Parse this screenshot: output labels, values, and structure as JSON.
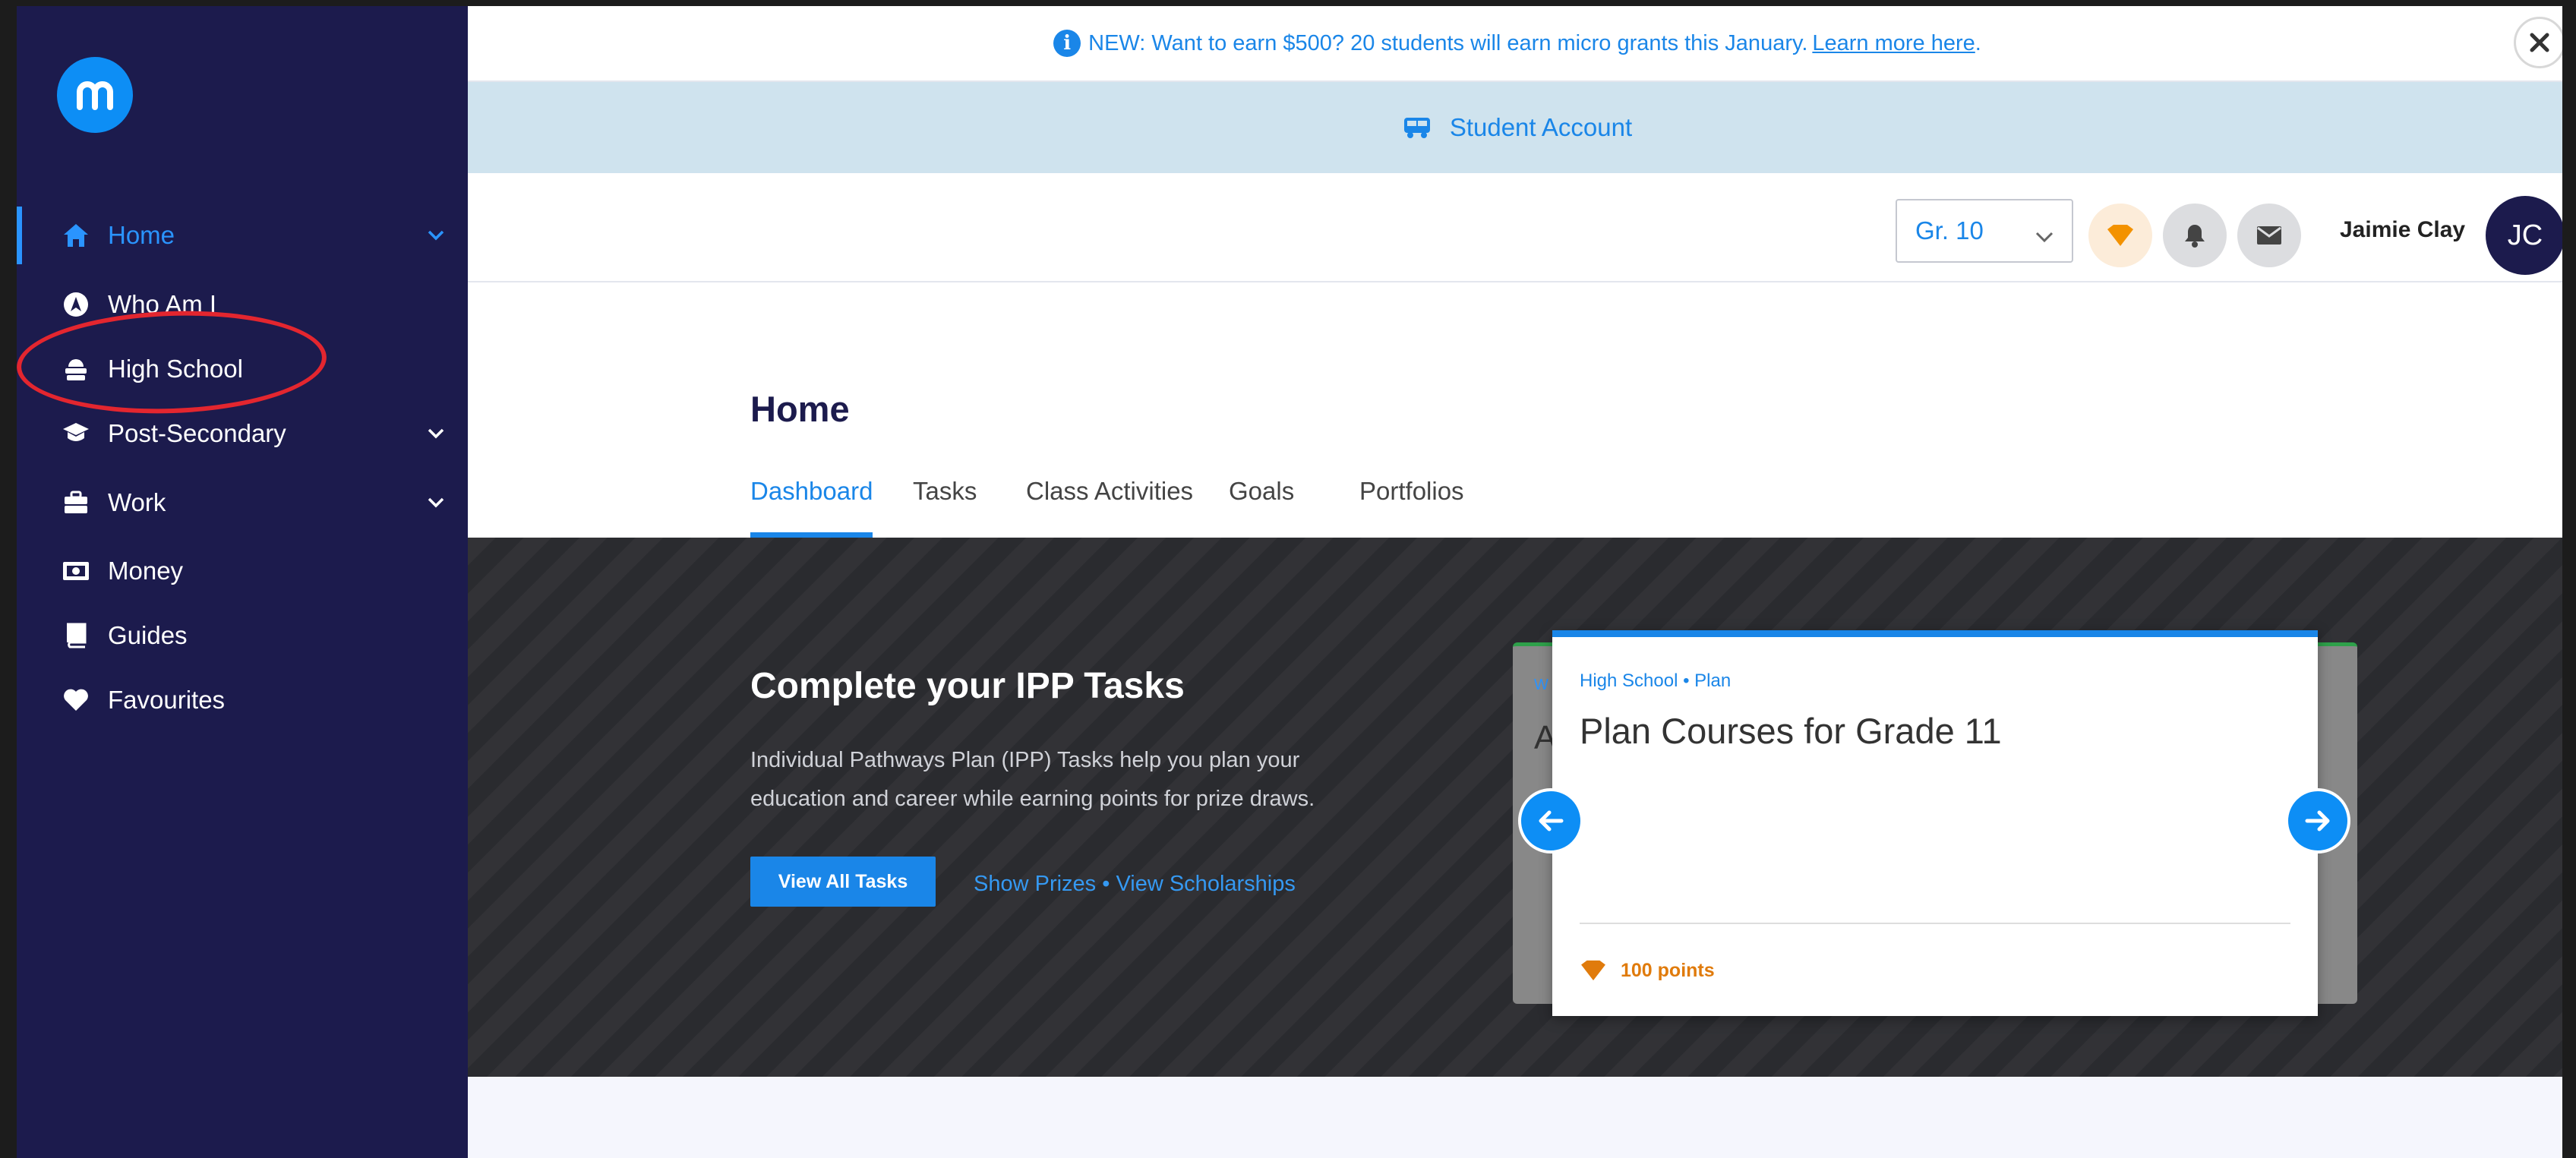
{
  "sidebar": {
    "items": [
      {
        "label": "Home",
        "icon": "home-icon",
        "active": true,
        "expandable": true
      },
      {
        "label": "Who Am I",
        "icon": "compass-icon",
        "active": false,
        "expandable": false
      },
      {
        "label": "High School",
        "icon": "school-icon",
        "active": false,
        "expandable": false
      },
      {
        "label": "Post-Secondary",
        "icon": "graduation-cap-icon",
        "active": false,
        "expandable": true
      },
      {
        "label": "Work",
        "icon": "briefcase-icon",
        "active": false,
        "expandable": true
      },
      {
        "label": "Money",
        "icon": "money-icon",
        "active": false,
        "expandable": false
      },
      {
        "label": "Guides",
        "icon": "book-icon",
        "active": false,
        "expandable": false
      },
      {
        "label": "Favourites",
        "icon": "heart-icon",
        "active": false,
        "expandable": false
      }
    ]
  },
  "banner": {
    "text": "NEW: Want to earn $500? 20 students will earn micro grants this January.",
    "link": "Learn more here",
    "suffix": "."
  },
  "account": {
    "label": "Student Account"
  },
  "topbar": {
    "grade": "Gr. 10",
    "user_name": "Jaimie Clay",
    "avatar_initials": "JC"
  },
  "page": {
    "title": "Home",
    "tabs": [
      "Dashboard",
      "Tasks",
      "Class Activities",
      "Goals",
      "Portfolios"
    ],
    "active_tab": "Dashboard"
  },
  "hero": {
    "title": "Complete your IPP Tasks",
    "desc_line1": "Individual Pathways Plan (IPP) Tasks help you plan your",
    "desc_line2": "education and career while earning points for prize draws.",
    "button": "View All Tasks",
    "link1": "Show Prizes",
    "separator": "•",
    "link2": "View Scholarships"
  },
  "card": {
    "crumb": "High School • Plan",
    "title": "Plan Courses for Grade 11",
    "points": "100 points",
    "back_peek1": "W",
    "back_peek2": "A"
  },
  "colors": {
    "sidebar": "#1c1b4d",
    "accent": "#1a86e8",
    "annotation": "#e3262f",
    "points": "#e07b0c"
  }
}
